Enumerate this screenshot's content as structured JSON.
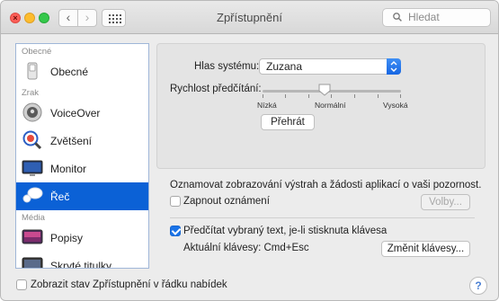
{
  "window": {
    "title": "Zpřístupnění"
  },
  "toolbar": {
    "back_icon": "chevron-left-icon",
    "forward_icon": "chevron-right-icon",
    "grid_icon": "grid-icon"
  },
  "search": {
    "placeholder": "Hledat"
  },
  "sidebar": {
    "sections": [
      {
        "header": "Obecné",
        "items": [
          {
            "label": "Obecné",
            "icon": "switch-icon"
          }
        ]
      },
      {
        "header": "Zrak",
        "items": [
          {
            "label": "VoiceOver",
            "icon": "voiceover-icon"
          },
          {
            "label": "Zvětšení",
            "icon": "magnifier-icon"
          },
          {
            "label": "Monitor",
            "icon": "monitor-icon"
          },
          {
            "label": "Řeč",
            "icon": "speech-bubble-icon",
            "selected": true
          }
        ]
      },
      {
        "header": "Média",
        "items": [
          {
            "label": "Popisy",
            "icon": "descriptions-icon"
          },
          {
            "label": "Skryté titulky",
            "icon": "captions-icon"
          }
        ]
      }
    ],
    "selected_color": "#0b61d6"
  },
  "speech": {
    "voice_label": "Hlas systému:",
    "voice_value": "Zuzana",
    "rate_label": "Rychlost předčítání:",
    "rate_ticks": [
      "Nízká",
      "Normální",
      "Vysoká"
    ],
    "rate_value": 0.45,
    "play_button": "Přehrát"
  },
  "announce": {
    "description": "Oznamovat zobrazování výstrah a žádosti aplikací o vaši pozornost.",
    "checkbox_label": "Zapnout oznámení",
    "checkbox_checked": false,
    "options_button": "Volby..."
  },
  "read_selection": {
    "checkbox_label": "Předčítat vybraný text, je-li stisknuta klávesa",
    "checkbox_checked": true,
    "keys_text": "Aktuální klávesy: Cmd+Esc",
    "change_button": "Změnit klávesy..."
  },
  "footer": {
    "checkbox_label": "Zobrazit stav Zpřístupnění v řádku nabídek",
    "checkbox_checked": false,
    "help_label": "?"
  }
}
